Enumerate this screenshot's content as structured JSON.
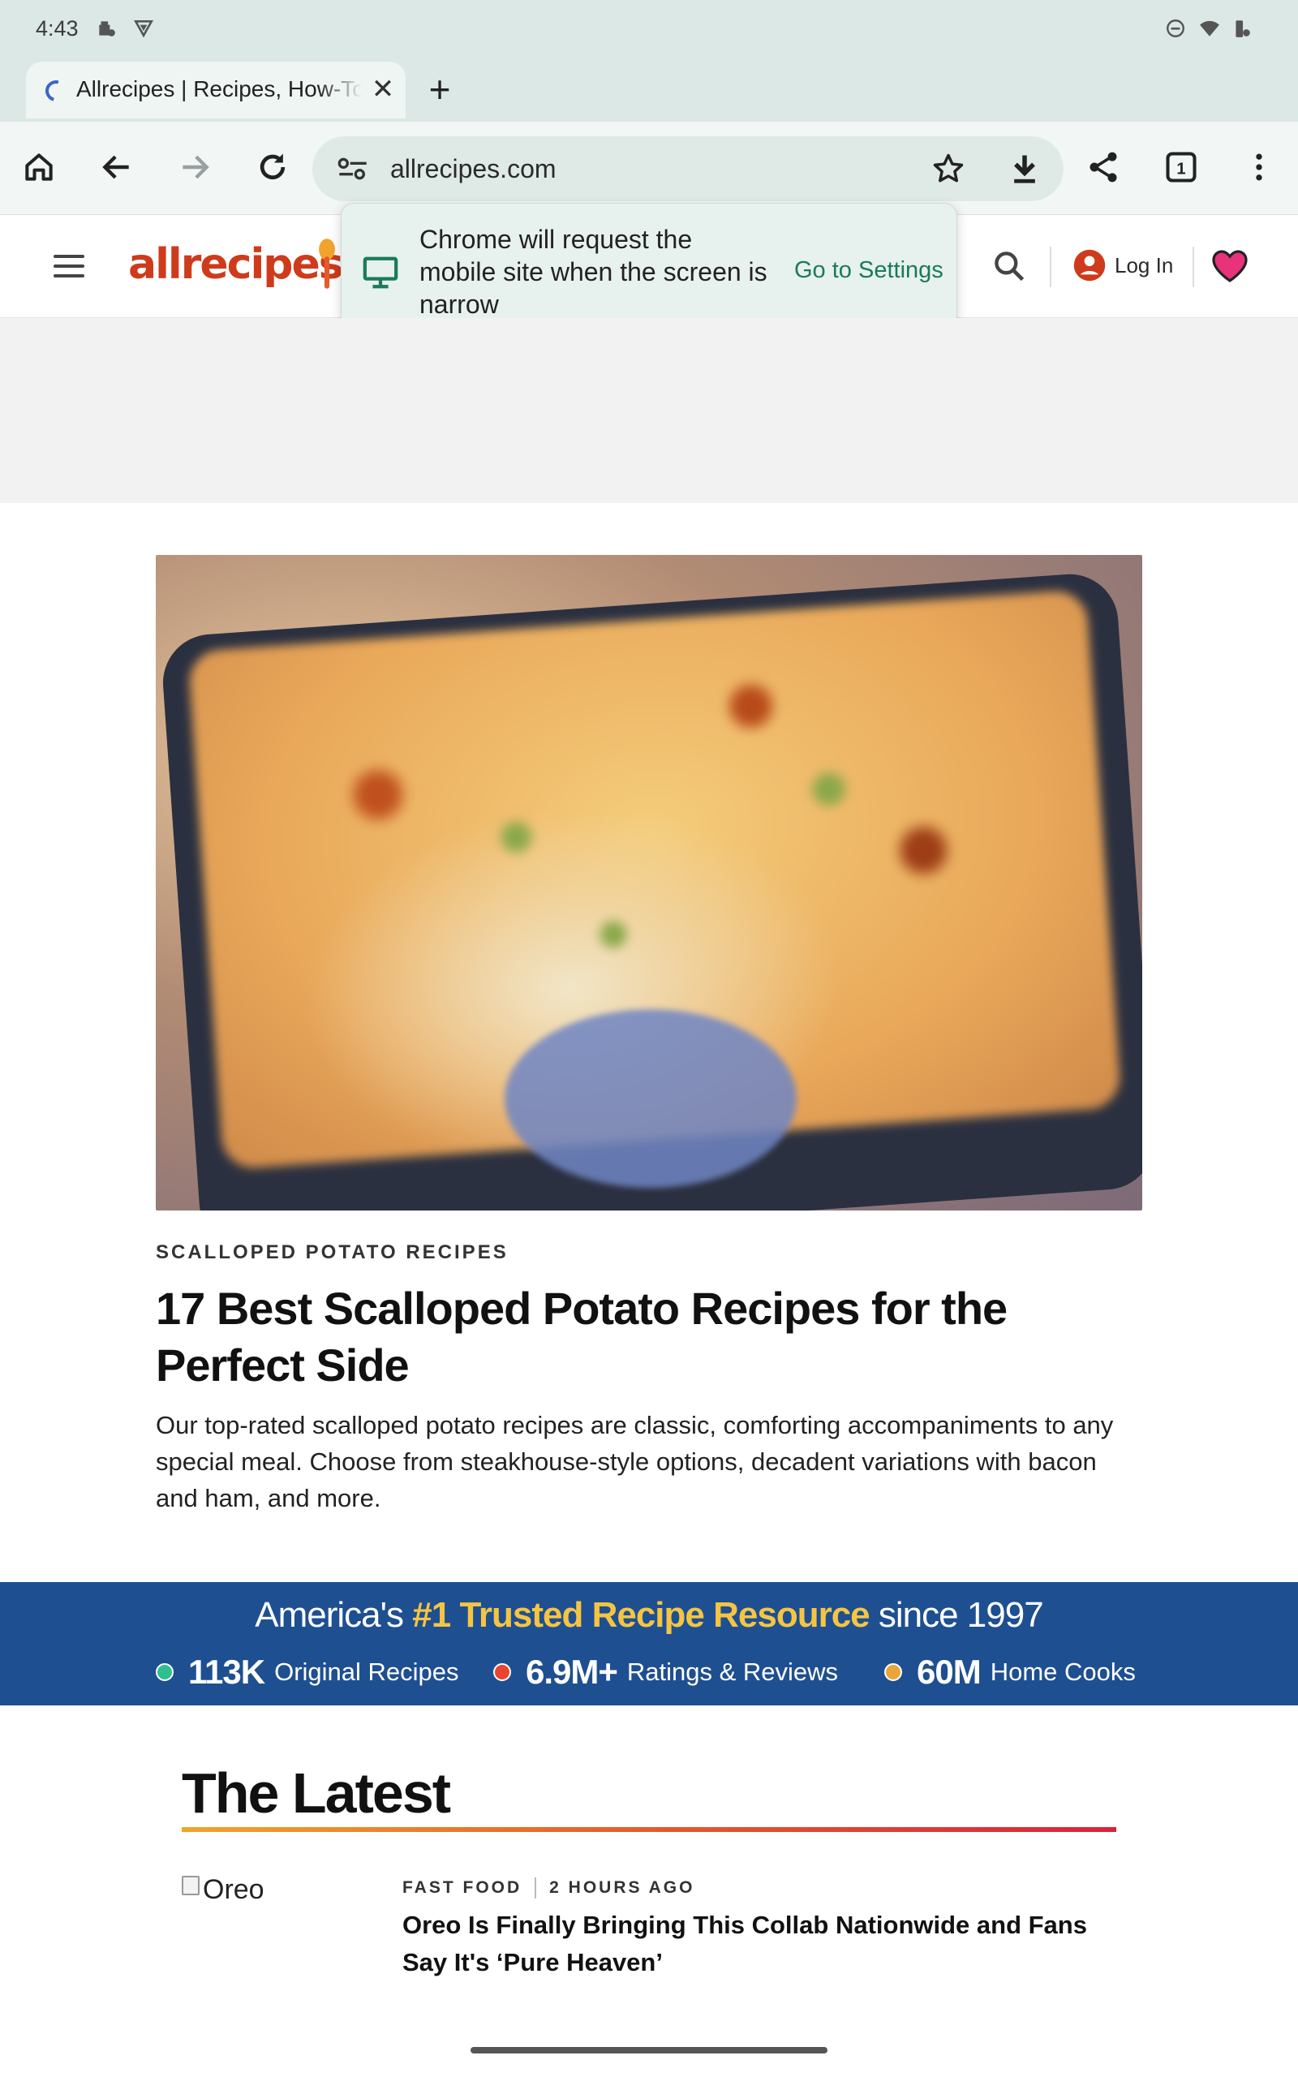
{
  "status_bar": {
    "time": "4:43"
  },
  "tab": {
    "title": "Allrecipes | Recipes, How-To Videos and More"
  },
  "toolbar": {
    "url": "allrecipes.com",
    "tab_count": "1"
  },
  "site_header": {
    "logo": "allrecipes",
    "login_label": "Log In"
  },
  "popup": {
    "message": "Chrome will request the mobile site when the screen is narrow",
    "action": "Go to Settings"
  },
  "article": {
    "kicker": "SCALLOPED POTATO RECIPES",
    "headline": "17 Best Scalloped Potato Recipes for the Perfect Side",
    "dek": "Our top-rated scalloped potato recipes are classic, comforting accompaniments to any special meal. Choose from steakhouse-style options, decadent variations with bacon and ham, and more."
  },
  "banner": {
    "title_pre": "America's ",
    "title_highlight": "#1 Trusted Recipe Resource",
    "title_post": " since 1997",
    "stats": [
      {
        "number": "113K",
        "label": "Original Recipes",
        "color": "#2fbf8f"
      },
      {
        "number": "6.9M+",
        "label": "Ratings & Reviews",
        "color": "#e8442f"
      },
      {
        "number": "60M",
        "label": "Home Cooks",
        "color": "#e9a73a"
      }
    ]
  },
  "latest": {
    "heading": "The Latest",
    "cards": [
      {
        "image_alt": "Oreo",
        "category": "FAST FOOD",
        "time": "2 HOURS AGO",
        "title": "Oreo Is Finally Bringing This Collab Nationwide and Fans Say It's ‘Pure Heaven’"
      }
    ]
  },
  "colors": {
    "logo": "#ce3b1c",
    "banner": "#1e4f91",
    "highlight": "#f5c542",
    "popup_action": "#1a7a5a"
  }
}
